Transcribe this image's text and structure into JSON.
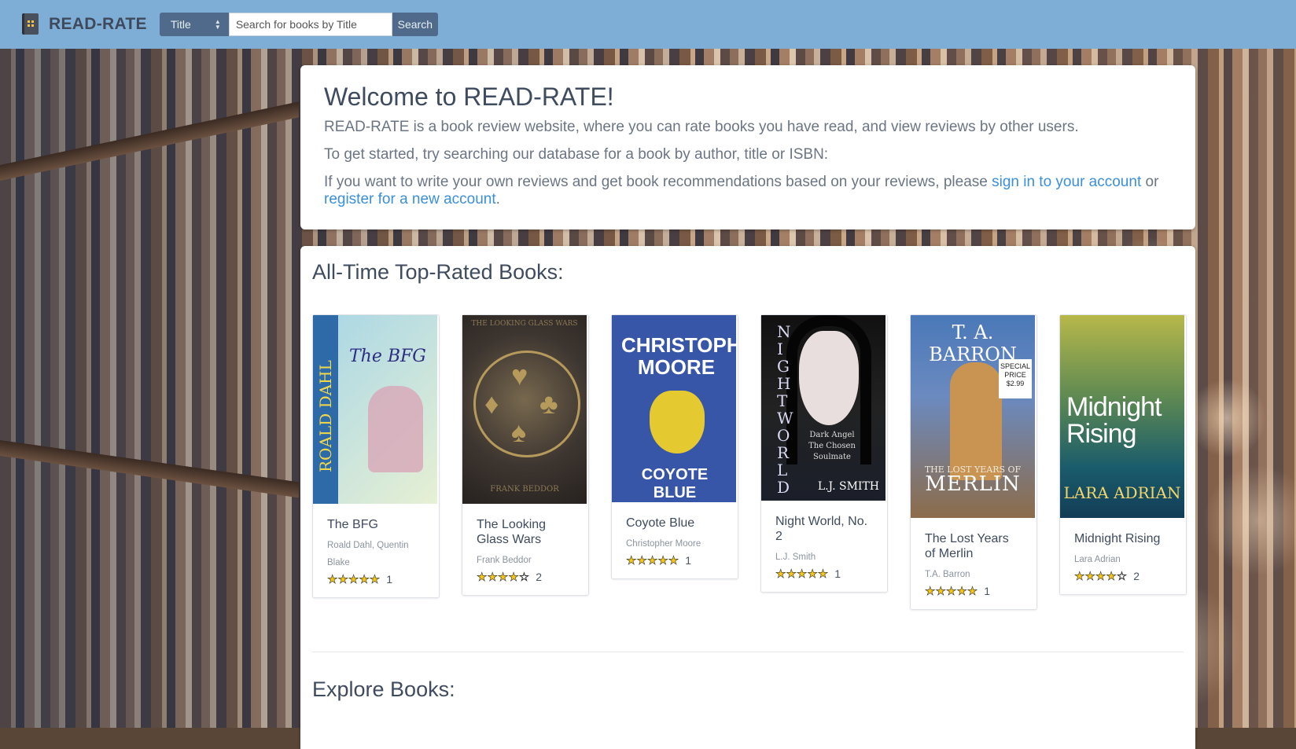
{
  "navbar": {
    "brand": "READ-RATE",
    "search": {
      "field_selected": "Title",
      "placeholder": "Search for books by Title",
      "button_label": "Search"
    }
  },
  "welcome": {
    "heading": "Welcome to READ-RATE!",
    "intro": "READ-RATE is a book review website, where you can rate books you have read, and view reviews by other users.",
    "get_started": "To get started, try searching our database for a book by author, title or ISBN:",
    "account_prefix": "If you want to write your own reviews and get book recommendations based on your reviews, please ",
    "sign_in_link": "sign in to your account",
    "or_text": " or ",
    "register_link": "register for a new account",
    "period": "."
  },
  "top_rated": {
    "heading": "All-Time Top-Rated Books:",
    "books": [
      {
        "title": "The BFG",
        "author": "Roald Dahl, Quentin Blake",
        "stars": "★★★★★",
        "rating": 5,
        "count": "1"
      },
      {
        "title": "The Looking Glass Wars",
        "author": "Frank Beddor",
        "stars": "★★★★☆",
        "rating": 4.5,
        "count": "2"
      },
      {
        "title": "Coyote Blue",
        "author": "Christopher Moore",
        "stars": "★★★★★",
        "rating": 5,
        "count": "1"
      },
      {
        "title": "Night World, No. 2",
        "author": "L.J. Smith",
        "stars": "★★★★★",
        "rating": 5,
        "count": "1"
      },
      {
        "title": "The Lost Years of Merlin",
        "author": "T.A. Barron",
        "stars": "★★★★★",
        "rating": 5,
        "count": "1"
      },
      {
        "title": "Midnight Rising",
        "author": "Lara Adrian",
        "stars": "★★★★☆",
        "rating": 4.5,
        "count": "2"
      }
    ]
  },
  "explore": {
    "heading": "Explore Books:"
  },
  "covers": {
    "bfg": {
      "title": "The BFG",
      "author": "ROALD DAHL"
    },
    "looking_glass": {
      "title": "THE LOOKING GLASS WARS",
      "author": "FRANK BEDDOR"
    },
    "coyote": {
      "author": "CHRISTOPHER MOORE",
      "title": "COYOTE BLUE"
    },
    "night_world": {
      "title": "NIGHT WORLD",
      "author": "L.J. SMITH",
      "contents": "Dark Angel The Chosen Soulmate"
    },
    "merlin": {
      "author": "T. A. BARRON",
      "title": "MERLIN",
      "subtitle": "THE LOST YEARS OF",
      "price": "SPECIAL PRICE $2.99"
    },
    "midnight": {
      "title": "Midnight Rising",
      "author": "LARA ADRIAN"
    }
  },
  "colors": {
    "navbar": "#7eaed6",
    "link": "#3b8fd9",
    "search_controls": "#4f6a8a",
    "star": "#f5c518"
  },
  "icons": {
    "logo": "book-icon",
    "select_caret": "sort-caret-icon",
    "rating": "star-icon"
  }
}
